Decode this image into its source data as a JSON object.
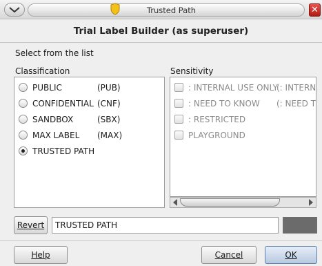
{
  "window": {
    "title": "Trusted Path",
    "header": "Trial Label Builder (as superuser)"
  },
  "instruction": "Select from the list",
  "classification": {
    "label": "Classification",
    "items": [
      {
        "name": "PUBLIC",
        "abbr": "(PUB)",
        "selected": false
      },
      {
        "name": "CONFIDENTIAL",
        "abbr": "(CNF)",
        "selected": false
      },
      {
        "name": "SANDBOX",
        "abbr": "(SBX)",
        "selected": false
      },
      {
        "name": "MAX LABEL",
        "abbr": "(MAX)",
        "selected": false
      },
      {
        "name": "TRUSTED PATH",
        "abbr": "",
        "selected": true
      }
    ]
  },
  "sensitivity": {
    "label": "Sensitivity",
    "items": [
      {
        "name": ": INTERNAL USE ONLY",
        "abbr": "(: INTERNA"
      },
      {
        "name": ": NEED TO KNOW",
        "abbr": "(: NEED TO"
      },
      {
        "name": ": RESTRICTED",
        "abbr": ""
      },
      {
        "name": "PLAYGROUND",
        "abbr": ""
      }
    ]
  },
  "label_field": {
    "revert_label": "Revert",
    "value": "TRUSTED PATH",
    "swatch_color": "#6b6b6b"
  },
  "footer": {
    "help_label": "Help",
    "cancel_label": "Cancel",
    "ok_label": "OK"
  },
  "colors": {
    "close_button": "#c8281f",
    "shield": "#f2c21b"
  }
}
